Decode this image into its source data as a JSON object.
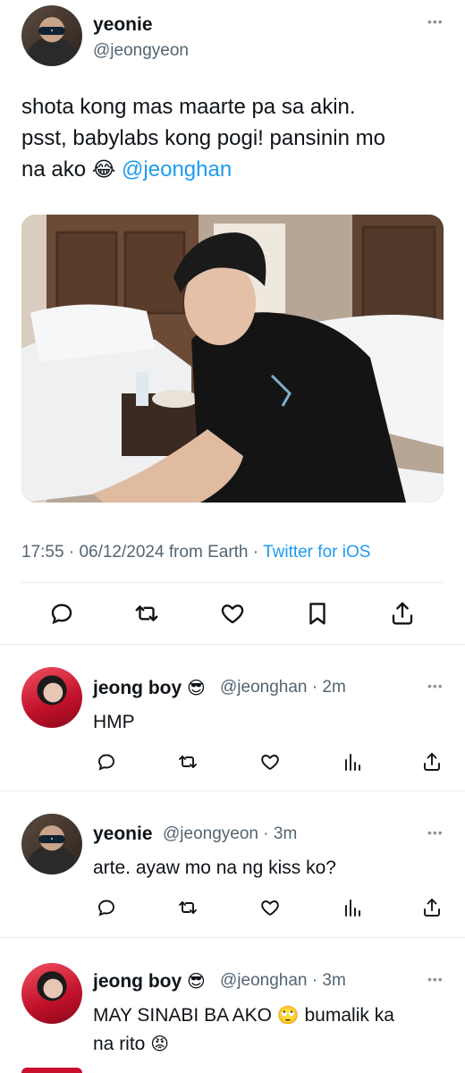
{
  "main_tweet": {
    "display_name": "yeonie",
    "handle": "@jeongyeon",
    "text_line1": "shota kong mas maarte pa sa akin.",
    "text_line2": "psst, babylabs kong pogi! pansinin mo",
    "text_line3_prefix": "na ako",
    "text_line3_emoji": "😂",
    "mention": "@jeonghan",
    "time": "17:55",
    "date": "06/12/2024",
    "location": "from Earth",
    "client": "Twitter for iOS",
    "dot": "·",
    "more": "•••"
  },
  "replies": [
    {
      "display_name": "jeong boy",
      "name_emoji": "😎",
      "handle": "@jeonghan",
      "time": "2m",
      "body": "HMP",
      "avatar": "red-hoodie-avatar"
    },
    {
      "display_name": "yeonie",
      "name_emoji": "",
      "handle": "@jeongyeon",
      "time": "3m",
      "body": "arte. ayaw mo na ng kiss ko?",
      "avatar": "sunglasses-avatar"
    },
    {
      "display_name": "jeong boy",
      "name_emoji": "😎",
      "handle": "@jeonghan",
      "time": "3m",
      "body_line1": "MAY SINABI BA AKO",
      "body_emoji1": "🙄",
      "body_line1_suffix": "bumalik ka",
      "body_line2": "na rito",
      "body_emoji2": "😡",
      "avatar": "red-hoodie-avatar"
    }
  ],
  "icons": {
    "reply": "reply-icon",
    "retweet": "retweet-icon",
    "like": "heart-icon",
    "bookmark": "bookmark-icon",
    "share": "share-icon",
    "views": "views-icon"
  },
  "colors": {
    "link": "#1d9bf0",
    "secondary_text": "#536471",
    "icon": "#536471",
    "main_icon": "#0f1419"
  }
}
